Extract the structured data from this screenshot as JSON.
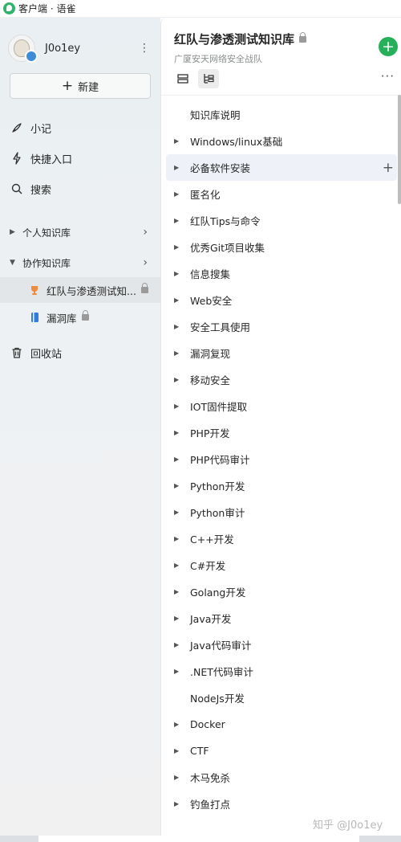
{
  "window": {
    "title": "客户端 · 语雀"
  },
  "sidebar": {
    "user": {
      "name": "J0o1ey"
    },
    "new_button": "新建",
    "nav": [
      {
        "label": "小记",
        "icon": "pen-icon"
      },
      {
        "label": "快捷入口",
        "icon": "lightning-icon"
      },
      {
        "label": "搜索",
        "icon": "search-icon"
      }
    ],
    "personal_library": "个人知识库",
    "collab_library": "协作知识库",
    "libraries": [
      {
        "label": "红队与渗透测试知...",
        "icon": "trophy-icon",
        "active": true
      },
      {
        "label": "漏洞库",
        "icon": "book-icon",
        "active": false
      }
    ],
    "trash": "回收站"
  },
  "main": {
    "title": "红队与渗透测试知识库",
    "subtitle": "广厦安天网络安全战队",
    "toc": [
      {
        "label": "知识库说明",
        "expandable": false
      },
      {
        "label": "Windows/linux基础",
        "expandable": true
      },
      {
        "label": "必备软件安装",
        "expandable": true,
        "hover": true
      },
      {
        "label": "匿名化",
        "expandable": true
      },
      {
        "label": "红队Tips与命令",
        "expandable": true
      },
      {
        "label": "优秀Git项目收集",
        "expandable": true
      },
      {
        "label": "信息搜集",
        "expandable": true
      },
      {
        "label": "Web安全",
        "expandable": true
      },
      {
        "label": "安全工具使用",
        "expandable": true
      },
      {
        "label": "漏洞复现",
        "expandable": true
      },
      {
        "label": "移动安全",
        "expandable": true
      },
      {
        "label": "IOT固件提取",
        "expandable": true
      },
      {
        "label": "PHP开发",
        "expandable": true
      },
      {
        "label": "PHP代码审计",
        "expandable": true
      },
      {
        "label": "Python开发",
        "expandable": true
      },
      {
        "label": "Python审计",
        "expandable": true
      },
      {
        "label": "C++开发",
        "expandable": true
      },
      {
        "label": "C#开发",
        "expandable": true
      },
      {
        "label": "Golang开发",
        "expandable": true
      },
      {
        "label": "Java开发",
        "expandable": true
      },
      {
        "label": "Java代码审计",
        "expandable": true
      },
      {
        "label": ".NET代码审计",
        "expandable": true
      },
      {
        "label": "NodeJs开发",
        "expandable": false
      },
      {
        "label": "Docker",
        "expandable": true
      },
      {
        "label": "CTF",
        "expandable": true
      },
      {
        "label": "木马免杀",
        "expandable": true
      },
      {
        "label": "钓鱼打点",
        "expandable": true
      }
    ]
  },
  "watermark": "知乎 @J0o1ey",
  "colors": {
    "accent": "#26b05a",
    "sidebar_bg": "#eef1f3",
    "hover_row": "#eef1f7"
  }
}
